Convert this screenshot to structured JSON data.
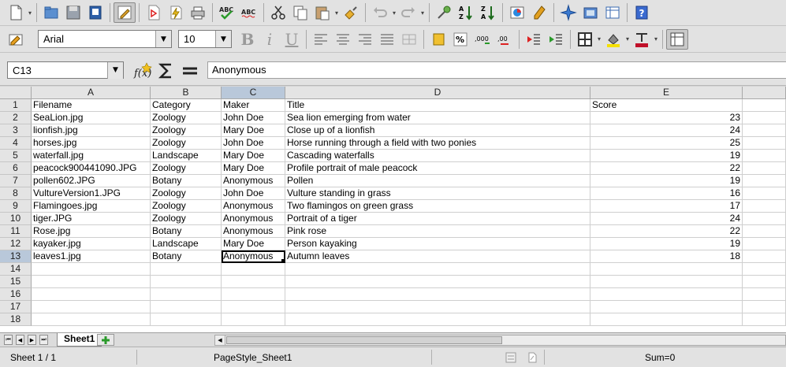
{
  "toolbar_standard": {
    "icons": [
      "new-icon",
      "open-icon",
      "save-icon",
      "edit-file-icon",
      "edit-mode-icon",
      "pdf-icon",
      "print-icon",
      "printer-icon",
      "spellcheck-icon",
      "autospell-icon",
      "cut-icon",
      "copy-icon",
      "paste-icon",
      "clone-format-icon",
      "undo-icon",
      "redo-icon",
      "hyperlink-icon",
      "sort-ascending-icon",
      "sort-descending-icon",
      "chart-icon",
      "draw-icon",
      "navigator-icon",
      "gallery-icon",
      "datasources-icon",
      "help-icon"
    ]
  },
  "toolbar_format": {
    "font_name": "Arial",
    "font_size": "10",
    "bold_label": "B",
    "italic_label": "i",
    "underline_label": "U"
  },
  "formula_bar": {
    "name_box": "C13",
    "content": "Anonymous"
  },
  "sheet": {
    "columns": [
      "A",
      "B",
      "C",
      "D",
      "E"
    ],
    "selected_column": "C",
    "rows": [
      {
        "n": "1",
        "cells": [
          "Filename",
          "Category",
          "Maker",
          "Title",
          "Score"
        ]
      },
      {
        "n": "2",
        "cells": [
          "SeaLion.jpg",
          "Zoology",
          "John Doe",
          "Sea lion emerging from water",
          "23"
        ]
      },
      {
        "n": "3",
        "cells": [
          "lionfish.jpg",
          "Zoology",
          "Mary Doe",
          "Close up of a lionfish",
          "24"
        ]
      },
      {
        "n": "4",
        "cells": [
          "horses.jpg",
          "Zoology",
          "John Doe",
          "Horse running through a field with two ponies",
          "25"
        ]
      },
      {
        "n": "5",
        "cells": [
          "waterfall.jpg",
          "Landscape",
          "Mary Doe",
          "Cascading waterfalls",
          "19"
        ]
      },
      {
        "n": "6",
        "cells": [
          "peacock900441090.JPG",
          "Zoology",
          "Mary Doe",
          "Profile portrait of male peacock",
          "22"
        ]
      },
      {
        "n": "7",
        "cells": [
          "pollen602.JPG",
          "Botany",
          "Anonymous",
          "Pollen",
          "19"
        ]
      },
      {
        "n": "8",
        "cells": [
          "VultureVersion1.JPG",
          "Zoology",
          "John Doe",
          "Vulture standing in grass",
          "16"
        ]
      },
      {
        "n": "9",
        "cells": [
          "Flamingoes.jpg",
          "Zoology",
          "Anonymous",
          "Two flamingos on green grass",
          "17"
        ]
      },
      {
        "n": "10",
        "cells": [
          "tiger.JPG",
          "Zoology",
          "Anonymous",
          "Portrait of a tiger",
          "24"
        ]
      },
      {
        "n": "11",
        "cells": [
          "Rose.jpg",
          "Botany",
          "Anonymous",
          "Pink rose",
          "22"
        ]
      },
      {
        "n": "12",
        "cells": [
          "kayaker.jpg",
          "Landscape",
          "Mary Doe",
          "Person kayaking",
          "19"
        ]
      },
      {
        "n": "13",
        "cells": [
          "leaves1.jpg",
          "Botany",
          "Anonymous",
          "Autumn leaves",
          "18"
        ]
      },
      {
        "n": "14",
        "cells": [
          "",
          "",
          "",
          "",
          ""
        ]
      },
      {
        "n": "15",
        "cells": [
          "",
          "",
          "",
          "",
          ""
        ]
      },
      {
        "n": "16",
        "cells": [
          "",
          "",
          "",
          "",
          ""
        ]
      },
      {
        "n": "17",
        "cells": [
          "",
          "",
          "",
          "",
          ""
        ]
      },
      {
        "n": "18",
        "cells": [
          "",
          "",
          "",
          "",
          ""
        ]
      }
    ],
    "active_row": "13"
  },
  "tabs": {
    "sheet_name": "Sheet1"
  },
  "status": {
    "sheet_pos": "Sheet 1 / 1",
    "page_style": "PageStyle_Sheet1",
    "sum": "Sum=0"
  },
  "colors": {
    "accent": "#b9c8da",
    "header_bg": "#e4e4e4"
  }
}
